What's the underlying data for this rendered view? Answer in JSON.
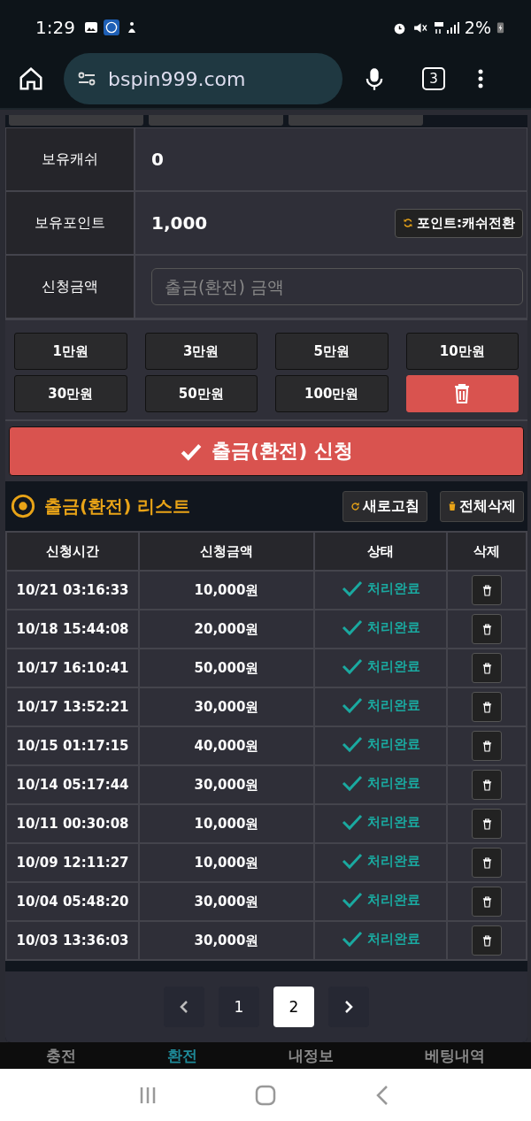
{
  "status_bar": {
    "time": "1:29",
    "battery": "2%"
  },
  "browser": {
    "url": "bspin999.com",
    "tab_count": "3"
  },
  "balance": [
    {
      "label": "보유캐쉬",
      "value": "0"
    },
    {
      "label": "보유포인트",
      "value": "1,000"
    }
  ],
  "convert_button": "포인트:캐쉬전환",
  "amount": {
    "label": "신청금액",
    "placeholder": "출금(환전) 금액"
  },
  "quick_amounts": [
    "1만원",
    "3만원",
    "5만원",
    "10만원",
    "30만원",
    "50만원",
    "100만원"
  ],
  "submit_button": "출금(환전) 신청",
  "list": {
    "title": "출금(환전) 리스트",
    "refresh_button": "새로고침",
    "delete_all_button": "전체삭제",
    "columns": [
      "신청시간",
      "신청금액",
      "상태",
      "삭제"
    ],
    "rows": [
      {
        "time": "10/21 03:16:33",
        "amount": "10,000원",
        "status": "처리완료"
      },
      {
        "time": "10/18 15:44:08",
        "amount": "20,000원",
        "status": "처리완료"
      },
      {
        "time": "10/17 16:10:41",
        "amount": "50,000원",
        "status": "처리완료"
      },
      {
        "time": "10/17 13:52:21",
        "amount": "30,000원",
        "status": "처리완료"
      },
      {
        "time": "10/15 01:17:15",
        "amount": "40,000원",
        "status": "처리완료"
      },
      {
        "time": "10/14 05:17:44",
        "amount": "30,000원",
        "status": "처리완료"
      },
      {
        "time": "10/11 00:30:08",
        "amount": "10,000원",
        "status": "처리완료"
      },
      {
        "time": "10/09 12:11:27",
        "amount": "10,000원",
        "status": "처리완료"
      },
      {
        "time": "10/04 05:48:20",
        "amount": "30,000원",
        "status": "처리완료"
      },
      {
        "time": "10/03 13:36:03",
        "amount": "30,000원",
        "status": "처리완료"
      }
    ]
  },
  "pagination": [
    {
      "label": "1",
      "selected": false
    },
    {
      "label": "2",
      "selected": true
    }
  ],
  "bottom_nav": [
    {
      "label": "충전",
      "selected": false
    },
    {
      "label": "환전",
      "selected": true
    },
    {
      "label": "내정보",
      "selected": false
    },
    {
      "label": "베팅내역",
      "selected": false
    }
  ]
}
